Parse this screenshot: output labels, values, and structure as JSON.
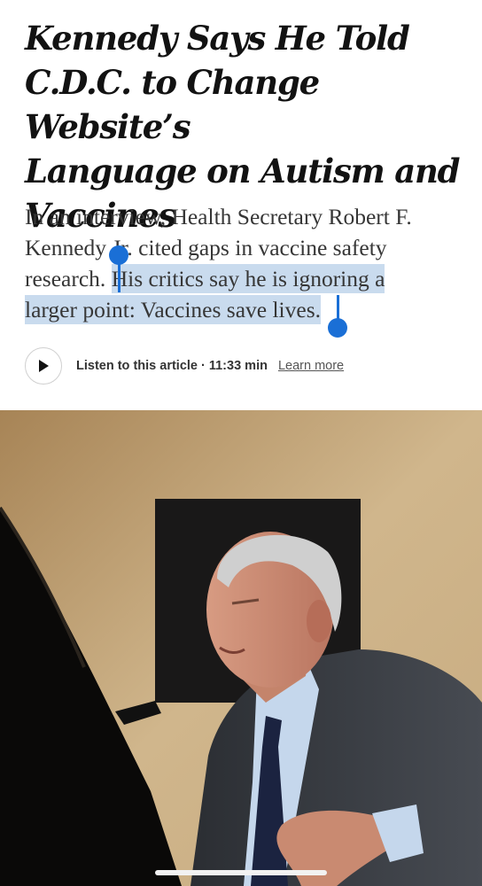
{
  "article": {
    "headline_lines": [
      "Kennedy Says He Told",
      "C.D.C. to Change Website’s",
      "Language on Autism and",
      "Vaccines"
    ],
    "summary_lines": [
      "In an interview, Health Secretary Robert F.",
      "Kennedy Jr. cited gaps in vaccine safety",
      "research.",
      "His critics say he is ignoring a",
      "larger point: Vaccines save lives."
    ]
  },
  "audio": {
    "play_icon": "play-icon",
    "listen_text": "Listen to this article · 11:33 min",
    "learn_more": "Learn more"
  },
  "colors": {
    "selection_highlight": "#c9dbee",
    "selection_handle": "#1a6fd6",
    "headline": "#121212",
    "summary": "#363636"
  },
  "photo": {
    "icon": "photo-image"
  }
}
